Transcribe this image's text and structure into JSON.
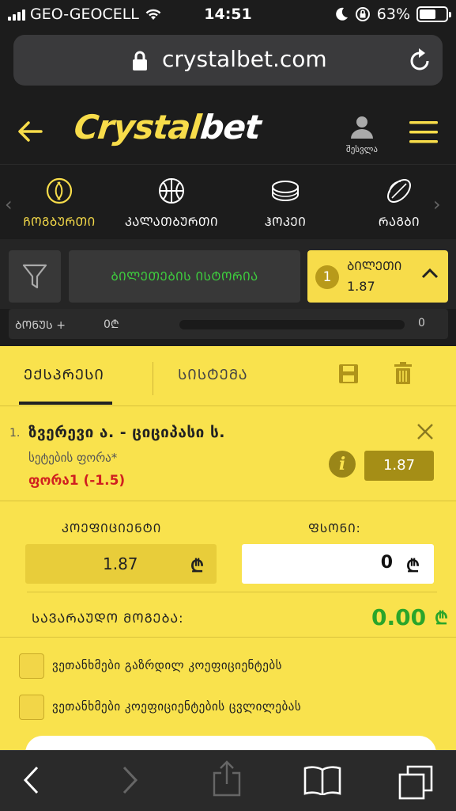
{
  "status_bar": {
    "carrier": "GEO-GEOCELL",
    "time": "14:51",
    "battery": "63%",
    "battery_level": 0.63
  },
  "browser": {
    "url": "crystalbet.com"
  },
  "header": {
    "logo_part1": "Crystal",
    "logo_part2": "bet",
    "login_label": "შესვლა"
  },
  "sports": [
    {
      "label": "ᲩᲝᲒᲑᲣᲠᲗᲘ",
      "icon": "tennis-ball-icon",
      "active": true
    },
    {
      "label": "ᲙᲐᲚᲐᲗᲑᲣᲠᲗᲘ",
      "icon": "basketball-icon",
      "active": false
    },
    {
      "label": "ᲰᲝᲙᲔᲘ",
      "icon": "hockey-puck-icon",
      "active": false
    },
    {
      "label": "ᲠᲐᲒᲑᲘ",
      "icon": "rugby-ball-icon",
      "active": false
    }
  ],
  "toolbar": {
    "history_label": "ᲑᲘᲚᲔᲗᲔᲑᲘᲡ ᲘᲡᲢᲝᲠᲘᲐ",
    "ticket_count": "1",
    "ticket_label": "ᲑᲘᲚᲔᲗᲘ",
    "ticket_odds": "1.87"
  },
  "bonus": {
    "label": "ᲑᲝᲜᲣᲡ +",
    "start": "0₾",
    "end": "0",
    "progress": 0
  },
  "slip": {
    "tab_express": "ᲔᲥᲡᲞᲠᲔᲡᲘ",
    "tab_system": "ᲡᲘᲡᲢᲔᲛᲐ",
    "bet": {
      "number": "1.",
      "match": "ზვერევი ა. - ციციპასი ს.",
      "market": "სეტების ფორა*",
      "pick": "ფორა1 (-1.5)",
      "odds": "1.87",
      "info_glyph": "i"
    },
    "coef_label": "ᲙᲝᲔᲤᲘᲪᲘᲔᲜᲢᲘ",
    "coef_value": "1.87",
    "amount_label": "ᲤᲡᲝᲜᲘ:",
    "amount_value": "0",
    "currency": "₾",
    "win_label": "ᲡᲐᲕᲐᲠᲐᲣᲓᲝ ᲛᲝᲒᲔᲑᲐ:",
    "win_value": "0.00",
    "option1": "ვეთანხმები გაზრდილ კოეფიციენტებს",
    "option2": "ვეთანხმები კოეფიციენტების ცვლილებას"
  },
  "colors": {
    "accent": "#f7dc4a",
    "green": "#3ecf3e",
    "pick_red": "#d02020"
  }
}
